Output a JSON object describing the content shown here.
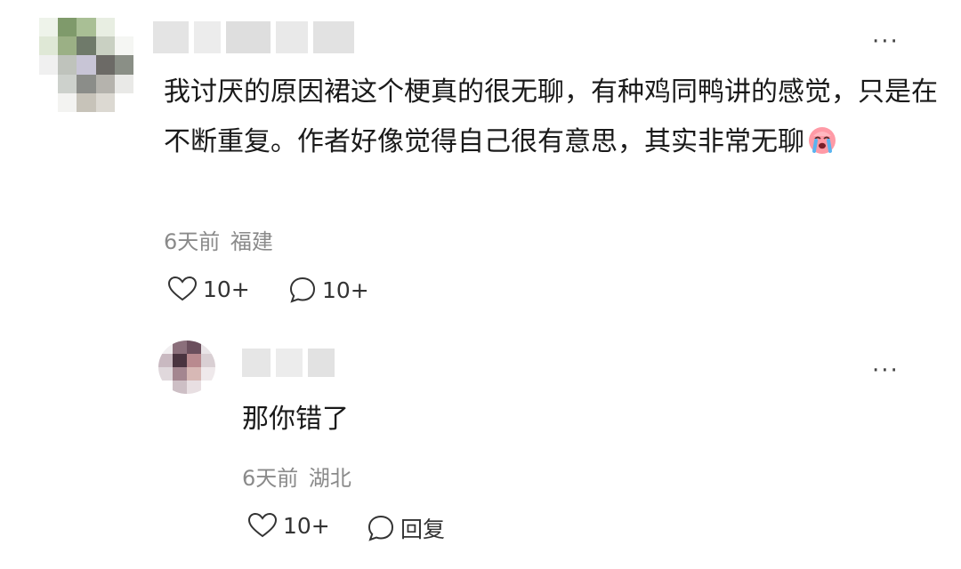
{
  "comment": {
    "text": "我讨厌的原因裙这个梗真的很无聊，有种鸡同鸭讲的感觉，只是在不断重复。作者好像觉得自己很有意思，其实非常无聊",
    "emoji_icon": "crying-face-emoji",
    "time": "6天前",
    "location": "福建",
    "like_count": "10+",
    "reply_count": "10+",
    "more_label": "···"
  },
  "reply": {
    "text": "那你错了",
    "time": "6天前",
    "location": "湖北",
    "like_count": "10+",
    "reply_label": "回复",
    "more_label": "···"
  },
  "colors": {
    "text": "#1a1a1a",
    "meta": "#8a8a8a",
    "background": "#ffffff"
  }
}
